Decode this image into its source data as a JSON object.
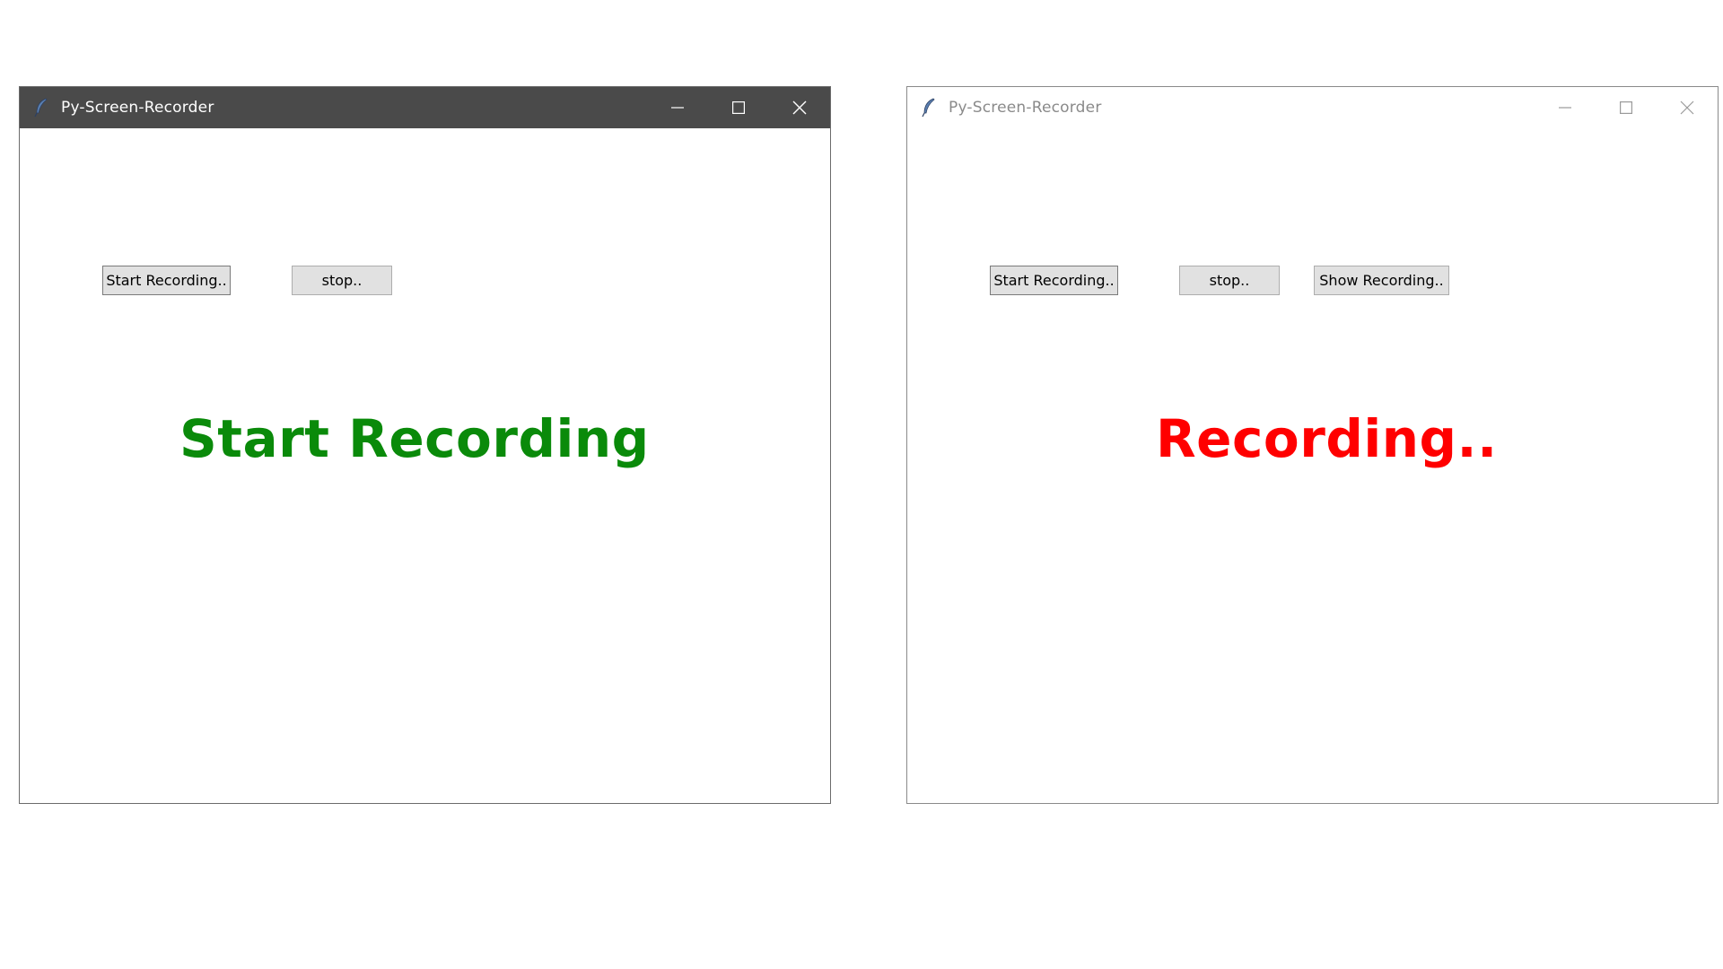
{
  "windows": [
    {
      "title": "Py-Screen-Recorder",
      "state": "active",
      "buttons": {
        "start": "Start Recording..",
        "stop": "stop.."
      },
      "status": {
        "text": "Start Recording",
        "color": "#0a8a0a"
      }
    },
    {
      "title": "Py-Screen-Recorder",
      "state": "inactive",
      "buttons": {
        "start": "Start Recording..",
        "stop": "stop..",
        "show": "Show Recording.."
      },
      "status": {
        "text": "Recording..",
        "color": "#ff0000"
      }
    }
  ],
  "icons": {
    "app": "feather-icon",
    "minimize": "minimize-icon",
    "maximize": "maximize-icon",
    "close": "close-icon"
  }
}
